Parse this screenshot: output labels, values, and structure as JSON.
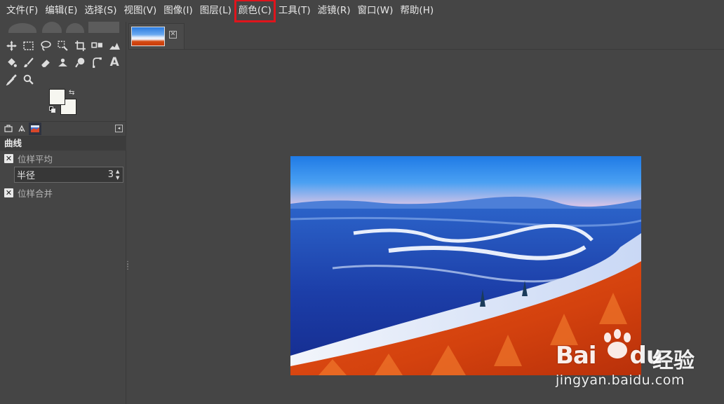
{
  "menu": [
    {
      "label": "文件(F)",
      "highlight": false
    },
    {
      "label": "编辑(E)",
      "highlight": false
    },
    {
      "label": "选择(S)",
      "highlight": false
    },
    {
      "label": "视图(V)",
      "highlight": false
    },
    {
      "label": "图像(I)",
      "highlight": false
    },
    {
      "label": "图层(L)",
      "highlight": false
    },
    {
      "label": "颜色(C)",
      "highlight": true
    },
    {
      "label": "工具(T)",
      "highlight": false
    },
    {
      "label": "滤镜(R)",
      "highlight": false
    },
    {
      "label": "窗口(W)",
      "highlight": false
    },
    {
      "label": "帮助(H)",
      "highlight": false
    }
  ],
  "toolbox": {
    "rows": [
      [
        "move-tool-icon",
        "rect-select-icon",
        "lasso-icon",
        "fuzzy-select-icon",
        "crop-icon",
        "transform-icon",
        "warp-icon"
      ],
      [
        "bucket-fill-icon",
        "paintbrush-icon",
        "eraser-icon",
        "clone-icon",
        "smudge-icon",
        "paths-icon",
        "text-icon"
      ],
      [
        "color-picker-icon",
        "zoom-icon"
      ]
    ],
    "text_tool_glyph": "A",
    "fg_color": "#f6f6f0",
    "bg_color": "#f6f6f0"
  },
  "tool_options": {
    "title": "曲线",
    "sample_average_label": "位样平均",
    "radius_label": "半径",
    "radius_value": "3",
    "sample_merged_label": "位样合并",
    "check_glyph": "✕"
  },
  "highlight_color": "#e0141c",
  "watermark": {
    "logo": "Bai",
    "logo_tail": "du",
    "cn": "经验",
    "url": "jingyan.baidu.com"
  }
}
